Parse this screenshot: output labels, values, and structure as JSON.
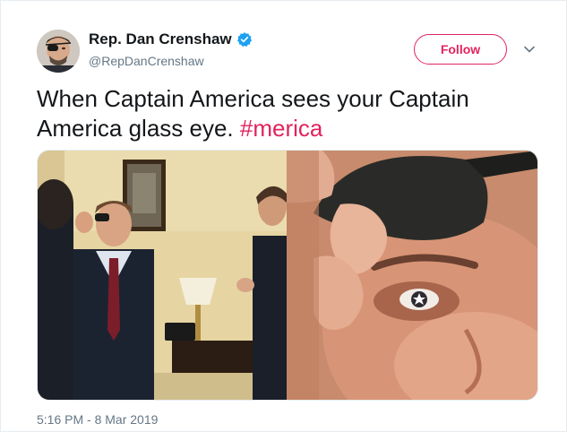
{
  "author": {
    "display_name": "Rep. Dan Crenshaw",
    "handle": "@RepDanCrenshaw",
    "verified": true
  },
  "actions": {
    "follow_label": "Follow",
    "caret_icon": "chevron-down-icon"
  },
  "tweet": {
    "text": "When Captain America sees your Captain America glass eye.",
    "hashtag": "#merica"
  },
  "media": {
    "photo_count": 2
  },
  "meta": {
    "timestamp": "5:16 PM - 8 Mar 2019"
  },
  "colors": {
    "accent": "#e0245e",
    "verified": "#1da1f2",
    "secondary_text": "#657786",
    "primary_text": "#14171a"
  }
}
